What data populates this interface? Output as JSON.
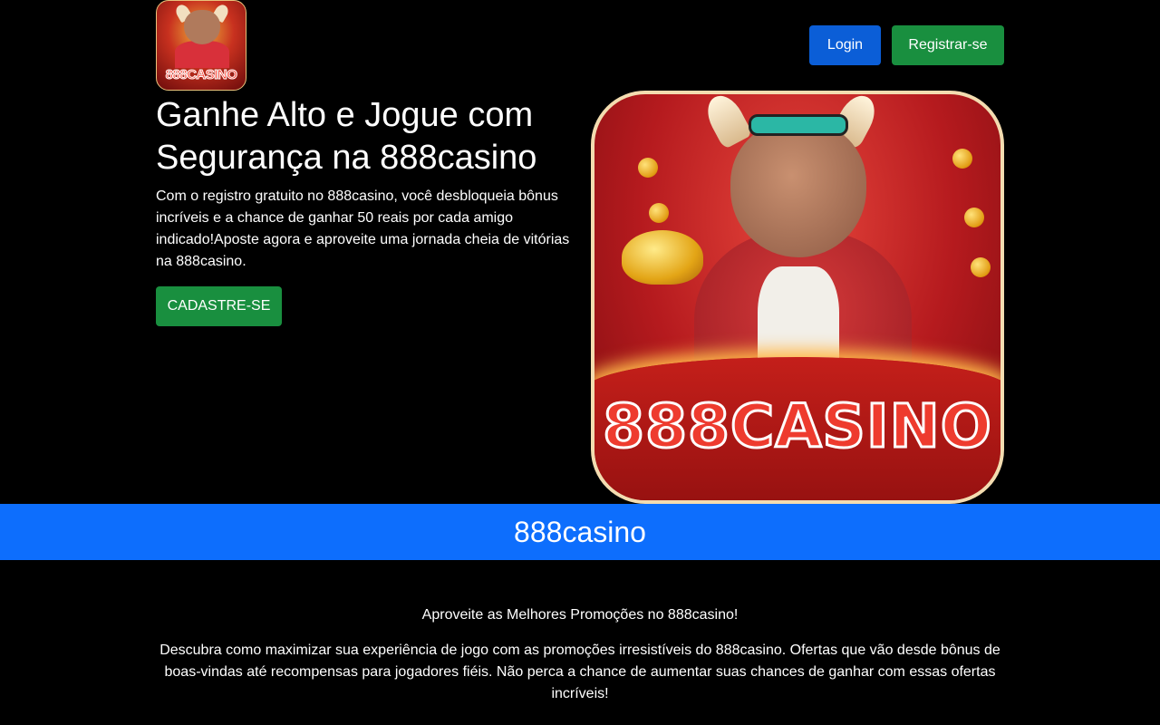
{
  "header": {
    "logo_text": "888CASINO",
    "login_label": "Login",
    "register_label": "Registrar-se"
  },
  "hero": {
    "title": "Ganhe Alto e Jogue com Segurança na 888casino",
    "text": "Com o registro gratuito no 888casino, você desbloqueia bônus incríveis e a chance de ganhar 50 reais por cada amigo indicado!Aposte agora e aproveite uma jornada cheia de vitórias na 888casino.",
    "cta_label": "CADASTRE-SE",
    "image_brand_text": "888CASINO"
  },
  "band": {
    "title": "888casino"
  },
  "content": {
    "heading": "Aproveite as Melhores Promoções no 888casino!",
    "paragraph": "Descubra como maximizar sua experiência de jogo com as promoções irresistíveis do 888casino. Ofertas que vão desde bônus de boas-vindas até recompensas para jogadores fiéis. Não perca a chance de aumentar suas chances de ganhar com essas ofertas incríveis!"
  },
  "colors": {
    "background": "#000000",
    "login_button": "#0b5ed7",
    "register_button": "#198f3f",
    "band": "#0d6efd"
  }
}
